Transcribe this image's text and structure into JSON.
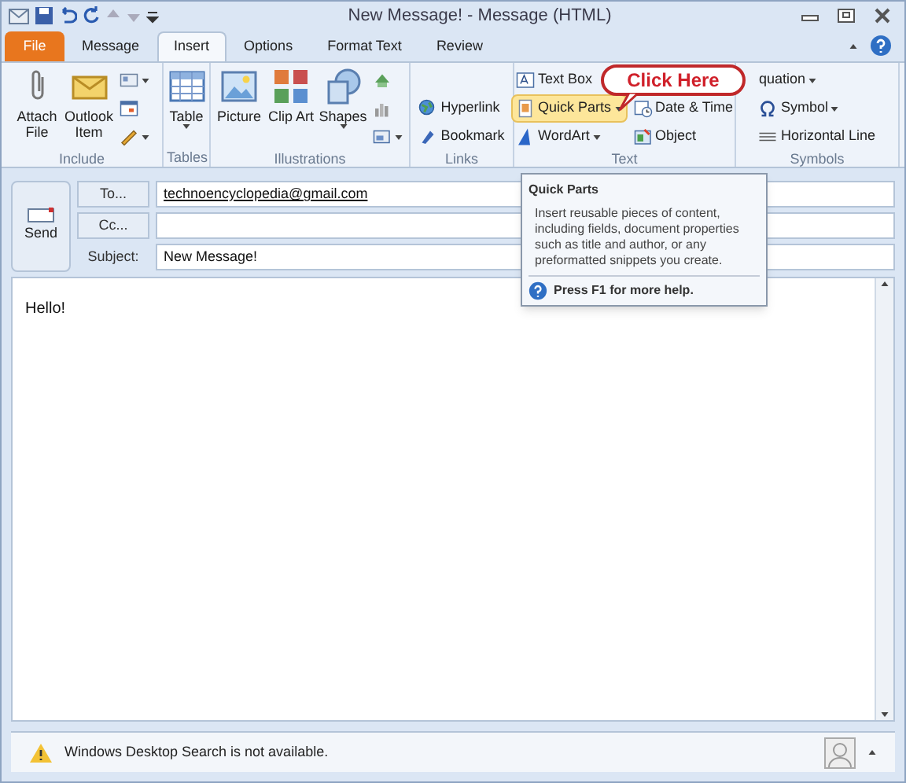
{
  "title_bar": {
    "title": "New Message! - Message (HTML)"
  },
  "tabs": [
    {
      "label": "File",
      "kind": "file",
      "selected": false
    },
    {
      "label": "Message",
      "kind": "normal",
      "selected": false
    },
    {
      "label": "Insert",
      "kind": "normal",
      "selected": true
    },
    {
      "label": "Options",
      "kind": "normal",
      "selected": false
    },
    {
      "label": "Format Text",
      "kind": "normal",
      "selected": false
    },
    {
      "label": "Review",
      "kind": "normal",
      "selected": false
    }
  ],
  "ribbon": {
    "groups": [
      {
        "label": "Include",
        "large": [
          {
            "label": "Attach File",
            "dropdown": false
          },
          {
            "label": "Outlook Item",
            "dropdown": false
          }
        ],
        "small": [
          {
            "kind": "icon",
            "dropdown": true
          },
          {
            "kind": "icon",
            "dropdown": false
          },
          {
            "kind": "icon",
            "dropdown": true
          }
        ]
      },
      {
        "label": "Tables",
        "large": [
          {
            "label": "Table",
            "dropdown": true
          }
        ]
      },
      {
        "label": "Illustrations",
        "large": [
          {
            "label": "Picture",
            "dropdown": false
          },
          {
            "label": "Clip Art",
            "dropdown": false
          },
          {
            "label": "Shapes",
            "dropdown": true
          }
        ],
        "small": [
          {
            "kind": "icon",
            "dropdown": false
          },
          {
            "kind": "icon",
            "dropdown": false
          },
          {
            "kind": "icon",
            "dropdown": true
          }
        ]
      },
      {
        "label": "Links",
        "small": [
          {
            "kind": "item",
            "label": "Hyperlink",
            "dropdown": false,
            "selected": false
          },
          {
            "kind": "item",
            "label": "Bookmark",
            "dropdown": false,
            "selected": false
          }
        ]
      },
      {
        "label": "Text",
        "small": [
          {
            "kind": "item",
            "label": "Text Box",
            "dropdown": false,
            "selected": false
          },
          {
            "kind": "item",
            "label": "Quick Parts",
            "dropdown": true,
            "selected": true
          },
          {
            "kind": "item",
            "label": "WordArt",
            "dropdown": true,
            "selected": false
          },
          {
            "kind": "item",
            "label": "Date & Time",
            "dropdown": false,
            "selected": false
          },
          {
            "kind": "item",
            "label": "Object",
            "dropdown": false,
            "selected": false
          }
        ]
      },
      {
        "label": "Symbols",
        "small": [
          {
            "kind": "item",
            "label": "quation",
            "dropdown": true,
            "selected": false
          },
          {
            "kind": "item",
            "label": "Symbol",
            "dropdown": true,
            "selected": false
          },
          {
            "kind": "item",
            "label": "Horizontal Line",
            "dropdown": false,
            "selected": false
          }
        ]
      }
    ]
  },
  "callout": {
    "text": "Click Here"
  },
  "tooltip": {
    "title": "Quick Parts",
    "body": "Insert reusable pieces of content, including fields, document properties such as title and author, or any preformatted snippets you create.",
    "help": "Press F1 for more help."
  },
  "compose": {
    "send": "Send",
    "fields": [
      {
        "label": "To...",
        "kind": "button",
        "value": "technoencyclopedia@gmail.com"
      },
      {
        "label": "Cc...",
        "kind": "button"
      },
      {
        "label": "Subject:",
        "kind": "label",
        "value": "New Message!"
      }
    ],
    "body": "Hello!"
  },
  "status_bar": {
    "text": "Windows Desktop Search is not available."
  }
}
